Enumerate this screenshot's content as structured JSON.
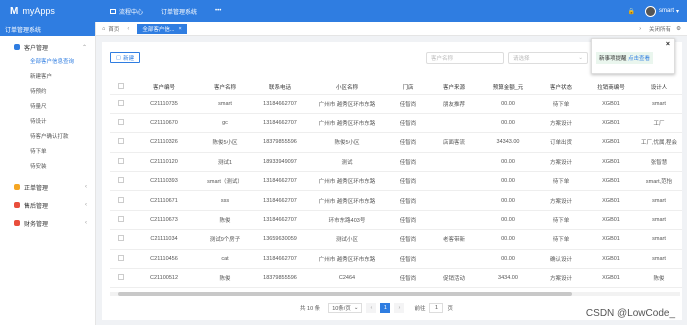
{
  "topbar": {
    "app_name": "myApps",
    "nav": [
      {
        "label": "流程中心"
      },
      {
        "label": "订单管理系统"
      },
      {
        "label": "•••"
      }
    ],
    "user": "smart",
    "accent": "#2f7de1"
  },
  "sidebar": {
    "title": "订单管理系统",
    "groups": [
      {
        "label": "客户管理",
        "icon": "users-icon",
        "color": "#2f7de1",
        "expanded": true,
        "items": [
          {
            "label": "全部客户信息查询",
            "active": true
          },
          {
            "label": "新建客户"
          },
          {
            "label": "待预约"
          },
          {
            "label": "待量尺"
          },
          {
            "label": "待设计"
          },
          {
            "label": "待客户确认打款"
          },
          {
            "label": "待下单"
          },
          {
            "label": "待安装"
          }
        ]
      },
      {
        "label": "正单管理",
        "icon": "folder-icon",
        "color": "#f5a623"
      },
      {
        "label": "售后管理",
        "icon": "service-icon",
        "color": "#e94e3c"
      },
      {
        "label": "财务管理",
        "icon": "finance-icon",
        "color": "#e94e3c"
      }
    ]
  },
  "tabs": {
    "home": "首页",
    "active_tab": "全部客户信...",
    "close_all": "关闭所有"
  },
  "toolbar": {
    "new_label": "新建",
    "filter1_placeholder": "客户名称",
    "filter2_placeholder": "请选择"
  },
  "popup": {
    "text": "新事项提醒",
    "link": "点击查看"
  },
  "table": {
    "columns": [
      "客户编号",
      "客户名称",
      "联系电话",
      "小区名称",
      "门店",
      "客户来源",
      "预算金额_元",
      "客户状态",
      "拉销商编号",
      "设计人"
    ],
    "rows": [
      [
        "C21110735",
        "smart",
        "13184662707",
        "广州市 越秀区环市东路",
        "佳智尚",
        "朋友推荐",
        "00.00",
        "待下单",
        "XGB01",
        "smart"
      ],
      [
        "C21110670",
        "gc",
        "13184662707",
        "广州市 越秀区环市东路",
        "佳智尚",
        "",
        "00.00",
        "方案设计",
        "XGB01",
        "工厂"
      ],
      [
        "C21110326",
        "陈俊5小区",
        "18379855596",
        "陈俊5小区",
        "佳智尚",
        "店面客流",
        "34343.00",
        "订单出货",
        "XGB01",
        "工厂,忧属,程会"
      ],
      [
        "C21110120",
        "测试1",
        "18933949097",
        "测试",
        "佳智尚",
        "",
        "00.00",
        "方案设计",
        "XGB01",
        "张智慧"
      ],
      [
        "C21110393",
        "smart（测试）",
        "13184662707",
        "广州市 越秀区环市东路",
        "佳智尚",
        "",
        "00.00",
        "待下单",
        "XGB01",
        "smart,范怡"
      ],
      [
        "C21110671",
        "sss",
        "13184662707",
        "广州市 越秀区环市东路",
        "佳智尚",
        "",
        "00.00",
        "方案设计",
        "XGB01",
        "smart"
      ],
      [
        "C21110673",
        "陈俊",
        "13184662707",
        "环市东路403号",
        "佳智尚",
        "",
        "00.00",
        "待下单",
        "XGB01",
        "smart"
      ],
      [
        "C21111034",
        "测试9个房子",
        "13659630059",
        "测试小区",
        "佳智尚",
        "老客带新",
        "00.00",
        "待下单",
        "XGB01",
        "smart"
      ],
      [
        "C21110456",
        "cat",
        "13184662707",
        "广州市 越秀区环市东路",
        "佳智尚",
        "",
        "00.00",
        "确认设计",
        "XGB01",
        "smart"
      ],
      [
        "C21100512",
        "陈俊",
        "18379855596",
        "C2464",
        "佳智尚",
        "促销活动",
        "3434.00",
        "方案设计",
        "XGB01",
        "陈俊"
      ]
    ]
  },
  "pager": {
    "total": "共 10 条",
    "page_size": "10条/页",
    "current": "1",
    "goto_label": "前往",
    "goto_value": "1",
    "page_suffix": "页"
  },
  "watermark": "CSDN @LowCode_"
}
